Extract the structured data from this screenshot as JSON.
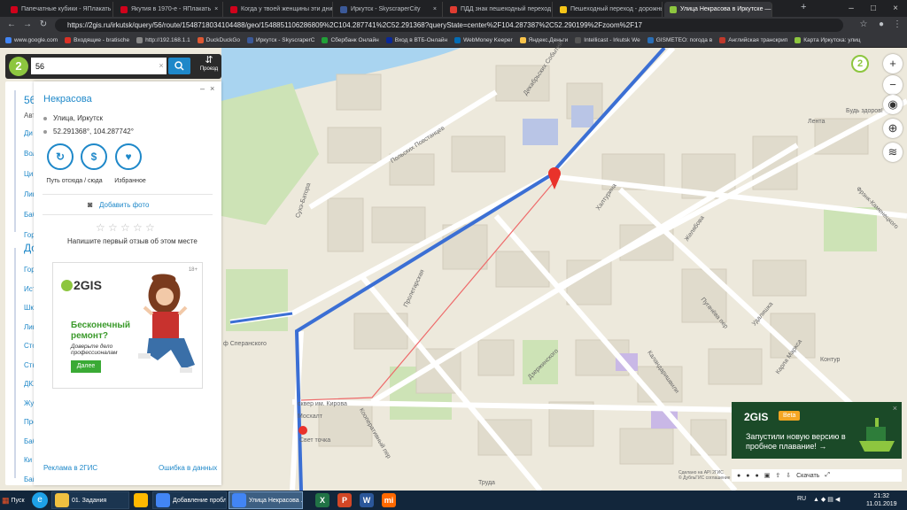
{
  "browser": {
    "tabs": [
      {
        "title": "Папечатные кубики - ЯПлакать",
        "color": "#d0021b"
      },
      {
        "title": "Якутия в 1970-е - ЯПлакать",
        "color": "#d0021b"
      },
      {
        "title": "Когда у твоей женщины эти дни -",
        "color": "#d0021b"
      },
      {
        "title": "Иркутск - SkyscraperCity",
        "color": "#3b5998"
      },
      {
        "title": "ПДД знак пешеходный переход о",
        "color": "#e03c31"
      },
      {
        "title": "Пешеходный переход - дорожны",
        "color": "#f5c518"
      },
      {
        "title": "Улица Некрасова в Иркутске — 2",
        "color": "#8dc63f"
      }
    ],
    "new_tab": "+",
    "url": "https://2gis.ru/irkutsk/query/56/route/1548718034104488/geo/1548851106286809%2C104.287741%2C52.291368?queryState=center%2F104.287387%2C52.290199%2Fzoom%2F17",
    "bookmarks": [
      {
        "label": "www.google.com",
        "color": "#4285f4"
      },
      {
        "label": "Входящие - bratische",
        "color": "#d93025"
      },
      {
        "label": "http://192.168.1.1",
        "color": "#888888"
      },
      {
        "label": "DuckDuckGo",
        "color": "#de5833"
      },
      {
        "label": "Иркутск - SkyscraperC",
        "color": "#3b5998"
      },
      {
        "label": "Сбербанк Онлайн",
        "color": "#21a038"
      },
      {
        "label": "Вход в ВТБ-Онлайн",
        "color": "#0a2896"
      },
      {
        "label": "WebMoney Keeper",
        "color": "#036cb5"
      },
      {
        "label": "Яндекс.Деньги",
        "color": "#f8c34a"
      },
      {
        "label": "Intellicast - Irkutsk We",
        "color": "#555555"
      },
      {
        "label": "GISMETEO: погода в",
        "color": "#2a6eb5"
      },
      {
        "label": "Английская транскрип",
        "color": "#c0392b"
      },
      {
        "label": "Карта Иркутска: улиц",
        "color": "#8dc63f"
      }
    ]
  },
  "search": {
    "value": "56",
    "clear": "×",
    "route_label": "Проезд"
  },
  "route_panel": {
    "title": "56",
    "prefix": "Авт",
    "stops": [
      "Ди",
      "Вол",
      "Ци",
      "Лиг",
      "Баб",
      "Гор"
    ],
    "section2": "До",
    "stops2": [
      "Гор",
      "Ист",
      "Шко",
      "Лиг",
      "Сто",
      "Стк",
      "ДКХ",
      "Жу",
      "Пре",
      "Баб",
      "Ки",
      "Бай"
    ]
  },
  "card": {
    "title": "Некрасова",
    "subtitle": "Улица, Иркутск",
    "coords": "52.291368°, 104.287742°",
    "actions": [
      {
        "icon": "↻",
        "label": "Путь отсюда / сюда"
      },
      {
        "icon": "$",
        "label": ""
      },
      {
        "icon": "♥",
        "label": "Избранное"
      }
    ],
    "add_photo": "Добавить фото",
    "review_prompt": "Напишите первый отзыв об этом месте",
    "ad": {
      "brand": "2GIS",
      "headline": "Бесконечный ремонт?",
      "text": "Доверьте дело профессионалам",
      "button": "Далее",
      "age": "18+"
    },
    "footer_left": "Реклама в 2ГИС",
    "footer_right": "Ошибка в данных"
  },
  "map": {
    "zoom_level": "2",
    "labels": [
      "Польских Повстанцев",
      "Декабрьских Событий",
      "Сухэ-Батора",
      "Пролетарская",
      "Халтурина",
      "Желябова",
      "Дзержинского",
      "Кооперативный пер",
      "Каландаришвили",
      "Пугачёва пер",
      "Карла Маркса",
      "Удалишка",
      "Фрэнк-Каменецкого",
      "Лента",
      "Будь здоров!",
      "Контур",
      "ф Сперанского",
      "сквер им. Кирова",
      "Труда",
      "Свет точка",
      "Мосхалт"
    ],
    "controls": [
      "+",
      "−",
      "◉",
      "⊕",
      "≋"
    ]
  },
  "promo": {
    "brand": "2GIS",
    "badge": "Beta",
    "text": "Запустили новую версию в пробное плавание! →",
    "close": "×"
  },
  "bottom_tools": {
    "download": "Скачать"
  },
  "copyright": "Сделано на API 2ГИС\n© ДубльГИС соглашение",
  "taskbar": {
    "start": "Пуск",
    "items": [
      {
        "label": "01. Задания",
        "color": "#f0c040",
        "icon": ""
      },
      {
        "label": "Добавление пробле...",
        "color": "#4285f4",
        "icon": ""
      },
      {
        "label": "Улица Некрасова ...",
        "color": "#4285f4",
        "icon": ""
      }
    ],
    "pinned": [
      {
        "icon": "X",
        "color": "#217346"
      },
      {
        "icon": "P",
        "color": "#d24726"
      },
      {
        "icon": "W",
        "color": "#2b579a"
      },
      {
        "icon": "mi",
        "color": "#ff6900"
      }
    ],
    "lang": "RU",
    "time": "21:32",
    "date": "11.01.2019"
  }
}
